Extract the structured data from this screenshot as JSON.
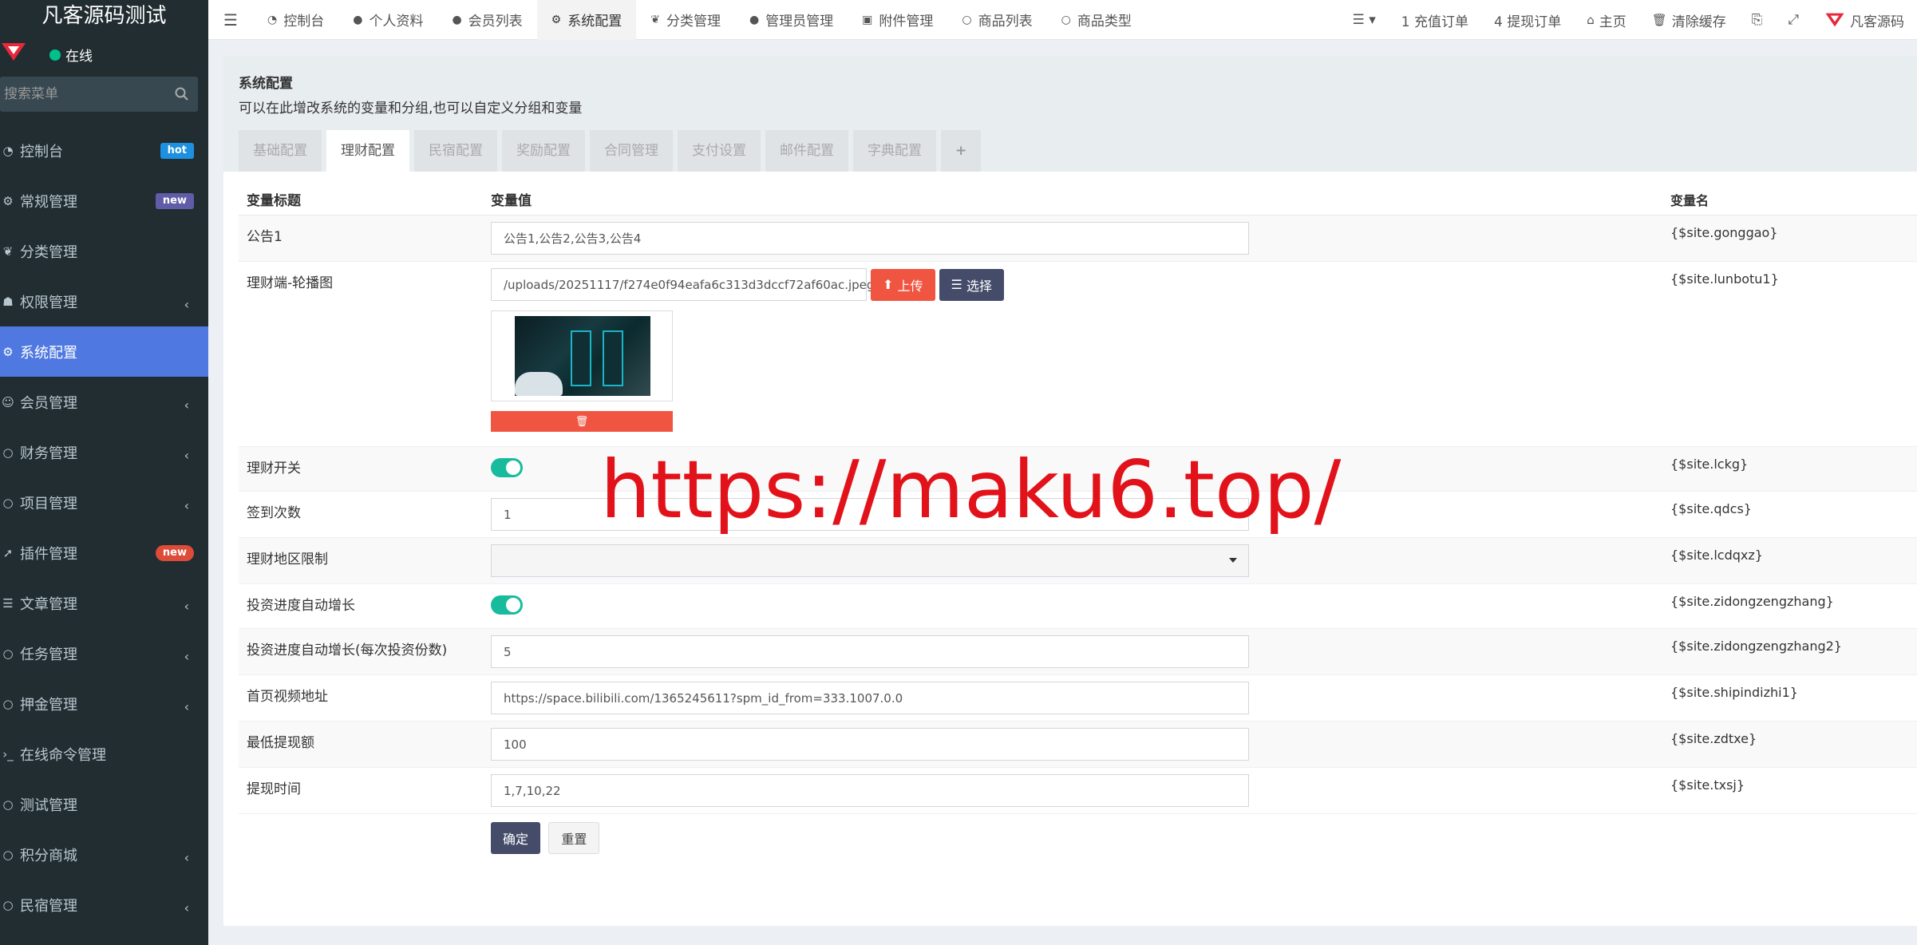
{
  "app": {
    "logo_text": "凡客源码测试",
    "user_status": "在线",
    "search_placeholder": "搜索菜单"
  },
  "sidebar": {
    "items": [
      {
        "label": "控制台",
        "icon": "dashboard-icon",
        "badge": "hot"
      },
      {
        "label": "常规管理",
        "icon": "cogs-icon",
        "badge": "new"
      },
      {
        "label": "分类管理",
        "icon": "leaf-icon"
      },
      {
        "label": "权限管理",
        "icon": "group-icon",
        "chevron": true
      },
      {
        "label": "系统配置",
        "icon": "gear-icon",
        "active": true
      },
      {
        "label": "会员管理",
        "icon": "user-circle-icon",
        "chevron": true
      },
      {
        "label": "财务管理",
        "icon": "circle-icon",
        "chevron": true
      },
      {
        "label": "项目管理",
        "icon": "circle-icon",
        "chevron": true
      },
      {
        "label": "插件管理",
        "icon": "rocket-icon",
        "badge": "new"
      },
      {
        "label": "文章管理",
        "icon": "list-icon",
        "chevron": true
      },
      {
        "label": "任务管理",
        "icon": "circle-icon",
        "chevron": true
      },
      {
        "label": "押金管理",
        "icon": "circle-icon",
        "chevron": true
      },
      {
        "label": "在线命令管理",
        "icon": "terminal-icon"
      },
      {
        "label": "测试管理",
        "icon": "circle-icon"
      },
      {
        "label": "积分商城",
        "icon": "circle-icon",
        "chevron": true
      },
      {
        "label": "民宿管理",
        "icon": "circle-icon",
        "chevron": true
      }
    ]
  },
  "topnav": {
    "tabs": [
      {
        "label": "控制台",
        "icon": "dashboard-icon"
      },
      {
        "label": "个人资料",
        "icon": "user-icon"
      },
      {
        "label": "会员列表",
        "icon": "user-icon"
      },
      {
        "label": "系统配置",
        "icon": "gear-icon",
        "active": true
      },
      {
        "label": "分类管理",
        "icon": "leaf-icon"
      },
      {
        "label": "管理员管理",
        "icon": "user-icon"
      },
      {
        "label": "附件管理",
        "icon": "image-icon"
      },
      {
        "label": "商品列表",
        "icon": "circle-icon"
      },
      {
        "label": "商品类型",
        "icon": "circle-icon"
      }
    ],
    "right": {
      "recharge": "1 充值订单",
      "withdraw": "4 提现订单",
      "home": "主页",
      "clear_cache": "清除缓存",
      "brand": "凡客源码"
    }
  },
  "panel": {
    "title": "系统配置",
    "description": "可以在此增改系统的变量和分组,也可以自定义分组和变量",
    "tabs": [
      "基础配置",
      "理财配置",
      "民宿配置",
      "奖励配置",
      "合同管理",
      "支付设置",
      "邮件配置",
      "字典配置"
    ],
    "active_tab": "理财配置",
    "add_tab": "+"
  },
  "table": {
    "headers": [
      "变量标题",
      "变量值",
      "变量名"
    ],
    "rows": [
      {
        "title": "公告1",
        "type": "text",
        "value": "公告1,公告2,公告3,公告4",
        "var": "{$site.gonggao}"
      },
      {
        "title": "理财端-轮播图",
        "type": "image",
        "value": "/uploads/20251117/f274e0f94eafa6c313d3dccf72af60ac.jpeg",
        "var": "{$site.lunbotu1}",
        "upload_label": "上传",
        "select_label": "选择"
      },
      {
        "title": "理财开关",
        "type": "switch",
        "value": true,
        "var": "{$site.lckg}"
      },
      {
        "title": "签到次数",
        "type": "text",
        "value": "1",
        "var": "{$site.qdcs}"
      },
      {
        "title": "理财地区限制",
        "type": "select",
        "value": "",
        "var": "{$site.lcdqxz}"
      },
      {
        "title": "投资进度自动增长",
        "type": "switch",
        "value": true,
        "var": "{$site.zidongzengzhang}"
      },
      {
        "title": "投资进度自动增长(每次投资份数)",
        "type": "text",
        "value": "5",
        "var": "{$site.zidongzengzhang2}"
      },
      {
        "title": "首页视频地址",
        "type": "text",
        "value": "https://space.bilibili.com/1365245611?spm_id_from=333.1007.0.0",
        "var": "{$site.shipindizhi1}"
      },
      {
        "title": "最低提现额",
        "type": "text",
        "value": "100",
        "var": "{$site.zdtxe}"
      },
      {
        "title": "提现时间",
        "type": "text",
        "value": "1,7,10,22",
        "var": "{$site.txsj}"
      }
    ]
  },
  "actions": {
    "submit": "确定",
    "reset": "重置"
  },
  "watermark": "https://maku6.top/",
  "colors": {
    "sidebar_bg": "#222d32",
    "active_menu": "#4f79e0",
    "switch_on": "#18bc9c",
    "danger": "#f05541",
    "dark_btn": "#444c69",
    "watermark": "#e2121a"
  }
}
